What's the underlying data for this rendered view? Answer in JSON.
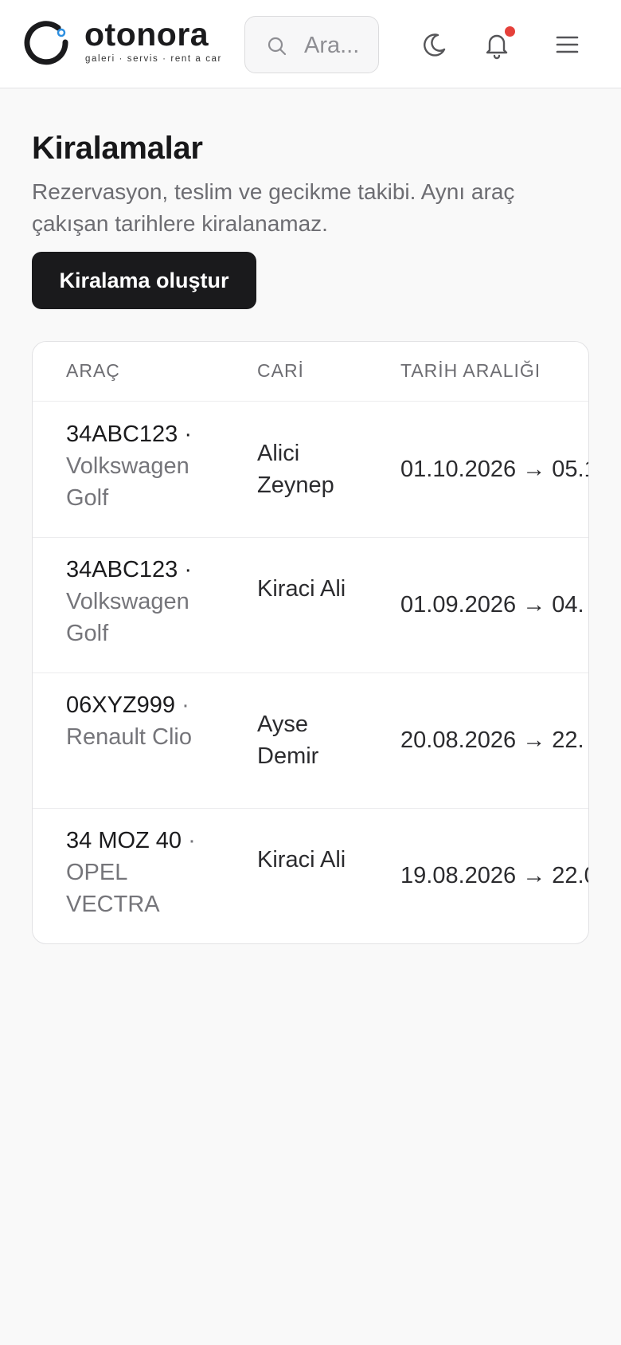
{
  "header": {
    "logo_name": "otonora",
    "logo_tagline": "galeri · servis · rent a car",
    "search_placeholder": "Ara...",
    "notification_dot_color": "#e5403a",
    "icons": [
      "search-icon",
      "moon-icon",
      "bell-icon",
      "menu-icon"
    ]
  },
  "page": {
    "title": "Kiralamalar",
    "subtitle": "Rezervasyon, teslim ve gecikme takibi. Aynı araç çakışan tarihlere kiralanamaz.",
    "create_button": "Kiralama oluştur"
  },
  "table": {
    "columns": [
      "ARAÇ",
      "CARİ",
      "TARİH ARALIĞI"
    ],
    "rows": [
      {
        "plate": "34ABC123 ·",
        "model": "Volkswagen Golf",
        "customer": "Alici Zeynep",
        "dates": "01.10.2026 → 05.1"
      },
      {
        "plate": "34ABC123 ·",
        "model": "Volkswagen Golf",
        "customer": "Kiraci Ali",
        "dates": "01.09.2026 → 04."
      },
      {
        "plate": "06XYZ999",
        "model": "· Renault Clio",
        "customer": "Ayse Demir",
        "dates": "20.08.2026 → 22."
      },
      {
        "plate": "34 MOZ 40",
        "model": "· OPEL VECTRA",
        "customer": "Kiraci Ali",
        "dates": "19.08.2026 → 22.0"
      }
    ]
  }
}
